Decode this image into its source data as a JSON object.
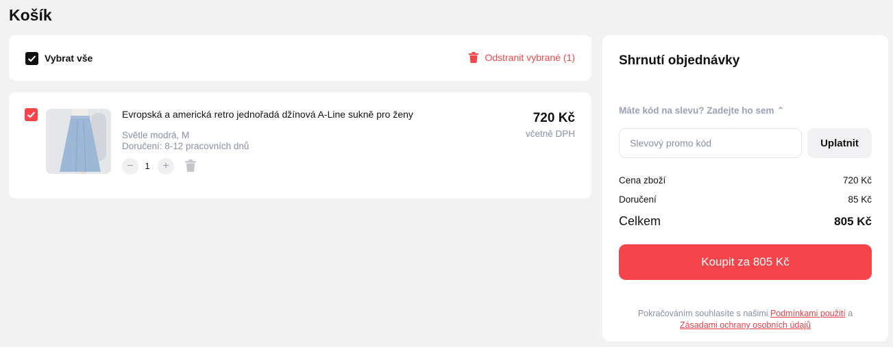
{
  "page": {
    "title": "Košík"
  },
  "cart": {
    "select_all_label": "Vybrat vše",
    "select_all_checked": true,
    "remove_selected_label": "Odstranit vybrané (1)",
    "items": [
      {
        "checked": true,
        "name": "Evropská a americká retro jednořadá džínová A-Line sukně pro ženy",
        "variant": "Světle modrá, M",
        "delivery": "Doručení: 8-12 pracovních dnů",
        "quantity": "1",
        "price": "720 Kč",
        "vat_note": "včetně DPH",
        "image_icon": "denim-skirt-photo"
      }
    ]
  },
  "summary": {
    "title": "Shrnutí objednávky",
    "promo_toggle": "Máte kód na slevu? Zadejte ho sem ⌃",
    "promo_placeholder": "Slevový promo kód",
    "apply_label": "Uplatnit",
    "goods_label": "Cena zboží",
    "goods_value": "720 Kč",
    "delivery_label": "Doručení",
    "delivery_value": "85 Kč",
    "total_label": "Celkem",
    "total_value": "805 Kč",
    "buy_label": "Koupit za 805 Kč",
    "legal_prefix": "Pokračováním souhlasíte s našimi ",
    "legal_terms": "Podmínkami použití",
    "legal_and": " a ",
    "legal_privacy": "Zásadami ochrany osobních údajů"
  },
  "colors": {
    "accent": "#f5454a",
    "muted": "#8a8fa6",
    "background": "#f2f2f2"
  }
}
